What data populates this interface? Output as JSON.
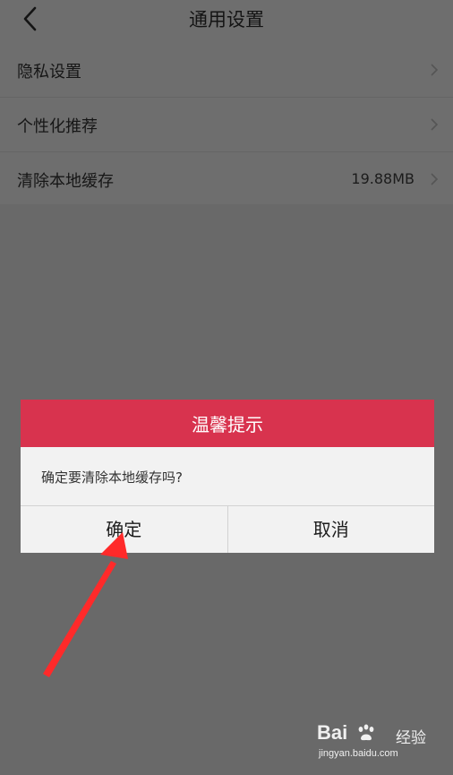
{
  "nav": {
    "title": "通用设置",
    "back_icon": "chevron-left-icon"
  },
  "settings": {
    "items": [
      {
        "label": "隐私设置",
        "value": ""
      },
      {
        "label": "个性化推荐",
        "value": ""
      },
      {
        "label": "清除本地缓存",
        "value": "19.88MB"
      }
    ],
    "chevron_icon": "chevron-right-icon"
  },
  "dialog": {
    "title": "温馨提示",
    "message": "确定要清除本地缓存吗?",
    "confirm_label": "确定",
    "cancel_label": "取消"
  },
  "watermark": {
    "brand": "Bai",
    "brand_icon": "paw-icon",
    "product": "经验",
    "url": "jingyan.baidu.com"
  },
  "colors": {
    "dialog_header": "#d8334e",
    "annotation_arrow": "#ff2a2a",
    "overlay_background": "#696969"
  }
}
